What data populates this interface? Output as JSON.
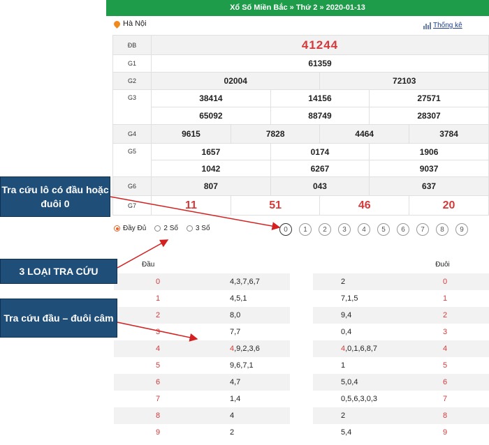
{
  "header": {
    "title": "Xổ Số Miền Bắc » Thứ 2 » 2020-01-13"
  },
  "location": {
    "label": "Hà Nội",
    "icon": "map-pin-icon"
  },
  "stats_link": {
    "label": "Thống kê",
    "icon": "bar-chart-icon"
  },
  "results": {
    "DB": {
      "label": "ĐB",
      "numbers": [
        "41244"
      ]
    },
    "G1": {
      "label": "G1",
      "numbers": [
        "61359"
      ]
    },
    "G2": {
      "label": "G2",
      "numbers": [
        "02004",
        "72103"
      ]
    },
    "G3": {
      "label": "G3",
      "numbers": [
        "38414",
        "14156",
        "27571",
        "65092",
        "88749",
        "28307"
      ]
    },
    "G4": {
      "label": "G4",
      "numbers": [
        "9615",
        "7828",
        "4464",
        "3784"
      ]
    },
    "G5": {
      "label": "G5",
      "numbers": [
        "1657",
        "0174",
        "1906",
        "1042",
        "6267",
        "9037"
      ]
    },
    "G6": {
      "label": "G6",
      "numbers": [
        "807",
        "043",
        "637"
      ]
    },
    "G7": {
      "label": "G7",
      "numbers": [
        "11",
        "51",
        "46",
        "20"
      ]
    }
  },
  "options": [
    {
      "label": "Đầy Đủ",
      "selected": true
    },
    {
      "label": "2 Số",
      "selected": false
    },
    {
      "label": "3 Số",
      "selected": false
    }
  ],
  "digit_buttons": [
    "0",
    "1",
    "2",
    "3",
    "4",
    "5",
    "6",
    "7",
    "8",
    "9"
  ],
  "dau_table": {
    "header": "Đầu",
    "rows": [
      {
        "digit": "0",
        "values": "4,3,7,6,7"
      },
      {
        "digit": "1",
        "values": "4,5,1"
      },
      {
        "digit": "2",
        "values": "8,0"
      },
      {
        "digit": "3",
        "values": "7,7"
      },
      {
        "digit": "4",
        "values": "4,9,2,3,6",
        "lead": "4",
        "rest": ",9,2,3,6"
      },
      {
        "digit": "5",
        "values": "9,6,7,1"
      },
      {
        "digit": "6",
        "values": "4,7"
      },
      {
        "digit": "7",
        "values": "1,4"
      },
      {
        "digit": "8",
        "values": "4"
      },
      {
        "digit": "9",
        "values": "2"
      }
    ]
  },
  "duoi_table": {
    "header": "Đuôi",
    "rows": [
      {
        "values": "2",
        "digit": "0"
      },
      {
        "values": "7,1,5",
        "digit": "1"
      },
      {
        "values": "9,4",
        "digit": "2"
      },
      {
        "values": "0,4",
        "digit": "3"
      },
      {
        "values": "4,0,1,6,8,7",
        "digit": "4",
        "lead": "4",
        "rest": ",0,1,6,8,7"
      },
      {
        "values": "1",
        "digit": "5"
      },
      {
        "values": "5,0,4",
        "digit": "6"
      },
      {
        "values": "0,5,6,3,0,3",
        "digit": "7"
      },
      {
        "values": "2",
        "digit": "8"
      },
      {
        "values": "5,4",
        "digit": "9"
      }
    ]
  },
  "callouts": [
    "Tra cứu lô có đầu hoặc đuôi 0",
    "3 LOẠI TRA CỨU",
    "Tra cứu đầu – đuôi câm"
  ],
  "colors": {
    "header_bg": "#1e9c4a",
    "highlight_red": "#d43a3a",
    "callout_bg": "#1f4e79",
    "arrow": "#d32020"
  }
}
